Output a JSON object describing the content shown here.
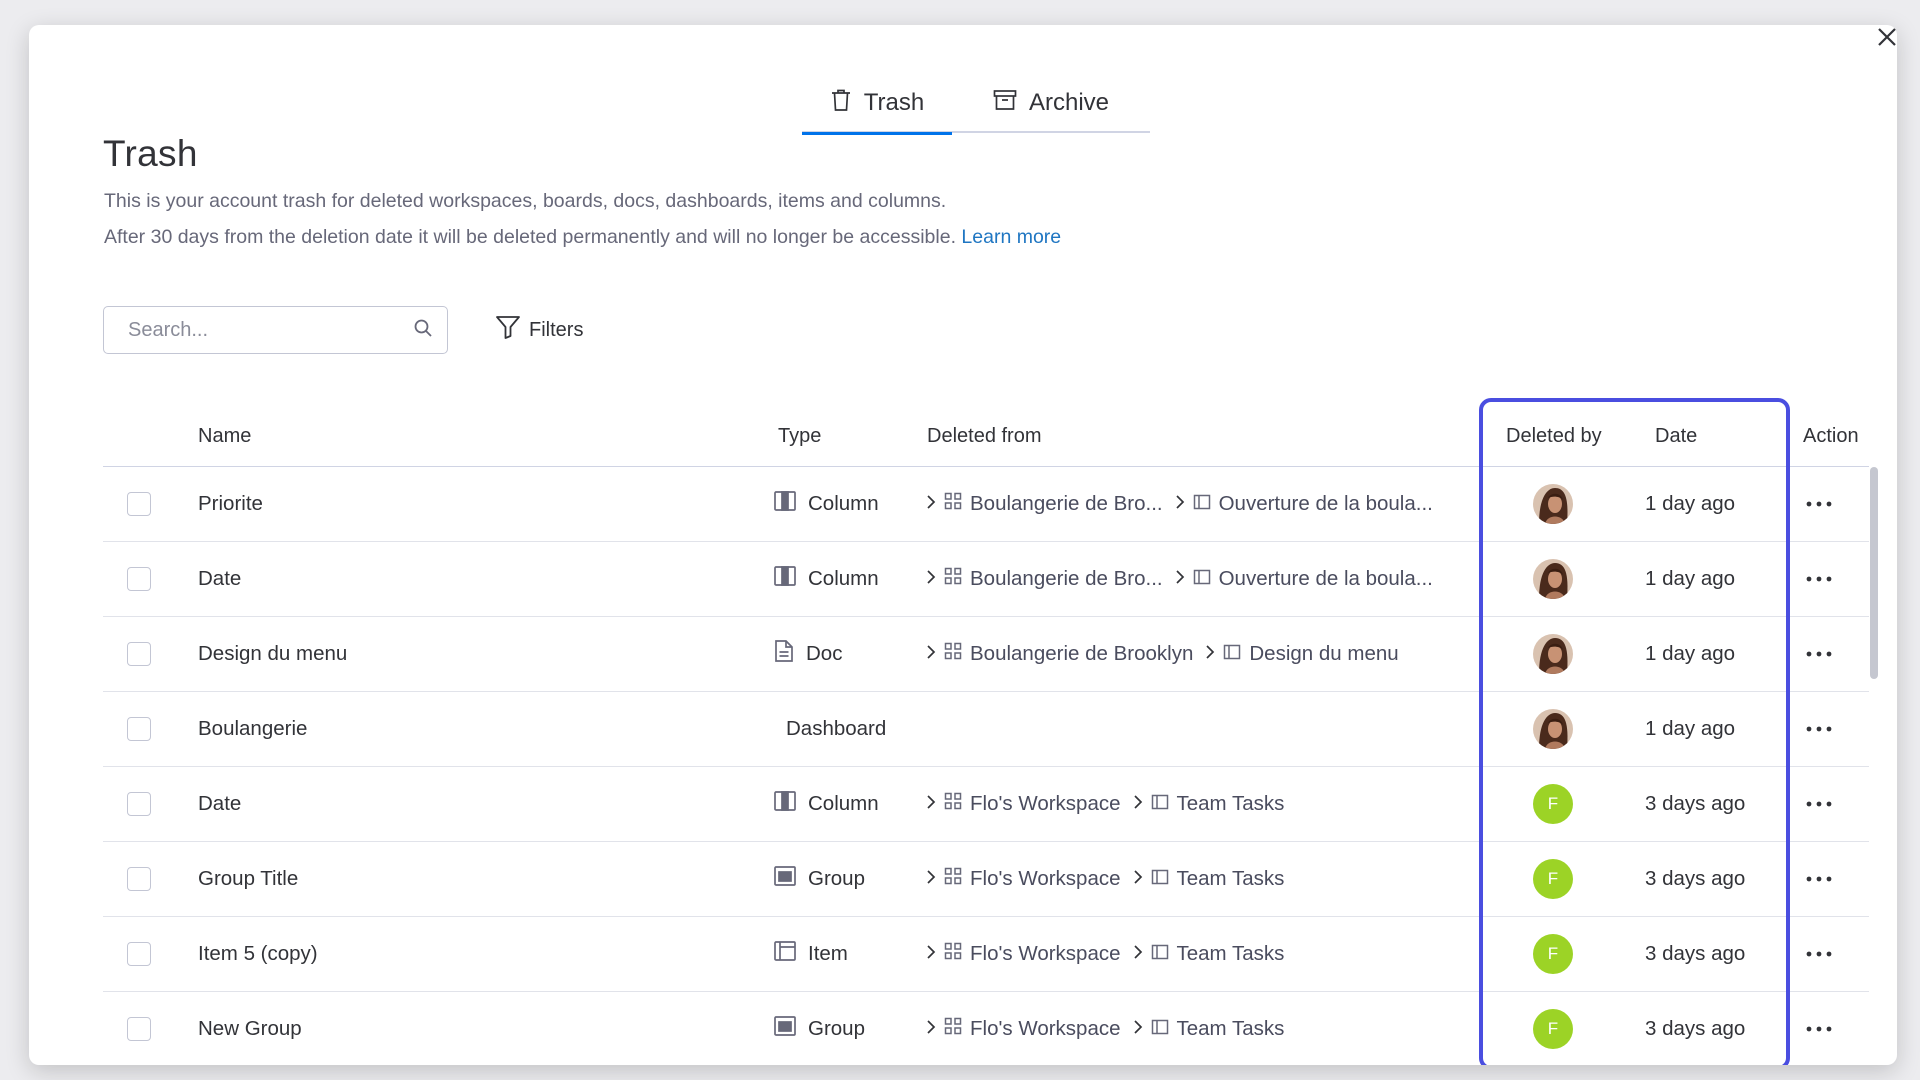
{
  "tabs": [
    {
      "label": "Trash",
      "icon": "trash-icon",
      "active": true
    },
    {
      "label": "Archive",
      "icon": "archive-icon",
      "active": false
    }
  ],
  "title": "Trash",
  "description": {
    "line1": "This is your account trash for deleted workspaces, boards, docs, dashboards, items and columns.",
    "line2": "After 30 days from the deletion date it will be deleted permanently and will no longer be accessible.",
    "learn_more": "Learn more"
  },
  "search": {
    "placeholder": "Search..."
  },
  "filters_label": "Filters",
  "columns": {
    "name": "Name",
    "type": "Type",
    "deleted_from": "Deleted from",
    "deleted_by": "Deleted by",
    "date": "Date",
    "action": "Action"
  },
  "rows": [
    {
      "name": "Priorite",
      "type": "Column",
      "type_icon": "column-icon",
      "workspace": "Boulangerie de Bro...",
      "board": "Ouverture de la boula...",
      "deleted_by": "photo",
      "date": "1 day ago"
    },
    {
      "name": "Date",
      "type": "Column",
      "type_icon": "column-icon",
      "workspace": "Boulangerie de Bro...",
      "board": "Ouverture de la boula...",
      "deleted_by": "photo",
      "date": "1 day ago"
    },
    {
      "name": "Design du menu",
      "type": "Doc",
      "type_icon": "doc-icon",
      "workspace": "Boulangerie de Brooklyn",
      "board": "Design du menu",
      "deleted_by": "photo",
      "date": "1 day ago"
    },
    {
      "name": "Boulangerie",
      "type": "Dashboard",
      "type_icon": "",
      "workspace": "",
      "board": "",
      "deleted_by": "photo",
      "date": "1 day ago"
    },
    {
      "name": "Date",
      "type": "Column",
      "type_icon": "column-icon",
      "workspace": "Flo's Workspace",
      "board": "Team Tasks",
      "deleted_by": "F",
      "date": "3 days ago"
    },
    {
      "name": "Group Title",
      "type": "Group",
      "type_icon": "group-icon",
      "workspace": "Flo's Workspace",
      "board": "Team Tasks",
      "deleted_by": "F",
      "date": "3 days ago"
    },
    {
      "name": "Item 5 (copy)",
      "type": "Item",
      "type_icon": "item-icon",
      "workspace": "Flo's Workspace",
      "board": "Team Tasks",
      "deleted_by": "F",
      "date": "3 days ago"
    },
    {
      "name": "New Group",
      "type": "Group",
      "type_icon": "group-icon",
      "workspace": "Flo's Workspace",
      "board": "Team Tasks",
      "deleted_by": "F",
      "date": "3 days ago"
    }
  ],
  "colors": {
    "accent": "#0073ea",
    "highlight": "#4a4ee0",
    "avatar_green": "#9cd326",
    "link": "#1f76c2"
  }
}
